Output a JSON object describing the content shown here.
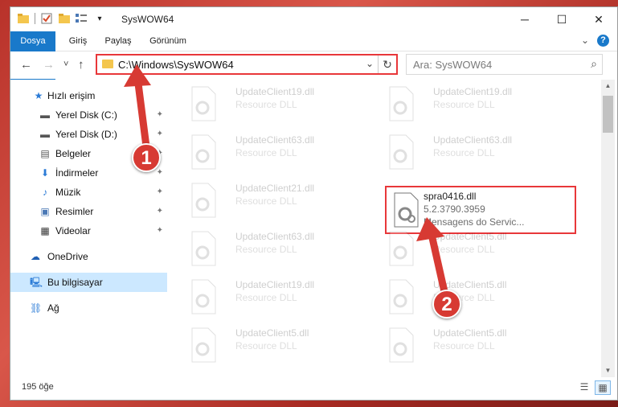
{
  "window": {
    "title": "SysWOW64",
    "controls": {
      "minimize": "─",
      "maximize": "☐",
      "close": "✕"
    }
  },
  "ribbon": {
    "tabs": [
      "Dosya",
      "Giriş",
      "Paylaş",
      "Görünüm"
    ],
    "expand": "⌄",
    "help": "?"
  },
  "navigation": {
    "back": "←",
    "forward": "→",
    "recent": "˅",
    "up": "↑",
    "address": "C:\\Windows\\SysWOW64",
    "address_dropdown": "⌄",
    "refresh": "↻",
    "search_placeholder": "Ara: SysWOW64",
    "search_icon": "⌕"
  },
  "sidebar": {
    "quick_access": "Hızlı erişim",
    "items": [
      {
        "label": "Yerel Disk (C:)",
        "icon": "drive-icon",
        "glyph": "▬",
        "pinned": true
      },
      {
        "label": "Yerel Disk (D:)",
        "icon": "drive-icon",
        "glyph": "▬",
        "pinned": true
      },
      {
        "label": "Belgeler",
        "icon": "documents-icon",
        "glyph": "▤",
        "pinned": true
      },
      {
        "label": "İndirmeler",
        "icon": "downloads-icon",
        "glyph": "⬇",
        "pinned": true
      },
      {
        "label": "Müzik",
        "icon": "music-icon",
        "glyph": "♪",
        "pinned": true
      },
      {
        "label": "Resimler",
        "icon": "pictures-icon",
        "glyph": "▣",
        "pinned": true
      },
      {
        "label": "Videolar",
        "icon": "videos-icon",
        "glyph": "▦",
        "pinned": true
      }
    ],
    "onedrive": "OneDrive",
    "this_pc": "Bu bilgisayar",
    "network": "Ağ",
    "pin_glyph": "📌"
  },
  "files": {
    "left_column": [
      {
        "name": "UpdateClient19.dll",
        "type": "Resource DLL"
      },
      {
        "name": "UpdateClient63.dll",
        "type": "Resource DLL"
      },
      {
        "name": "UpdateClient21.dll",
        "type": "Resource DLL"
      },
      {
        "name": "UpdateClient63.dll",
        "type": "Resource DLL"
      },
      {
        "name": "UpdateClient19.dll",
        "type": "Resource DLL"
      },
      {
        "name": "UpdateClient5.dll",
        "type": "Resource DLL"
      }
    ],
    "right_column": [
      {
        "name": "UpdateClient19.dll",
        "type": "Resource DLL"
      },
      {
        "name": "UpdateClient63.dll",
        "type": "Resource DLL"
      },
      {
        "name": "UpdateClient5.dll",
        "type": "Resource DLL"
      },
      {
        "name": "UpdateClient5.dll",
        "type": "Resource DLL"
      },
      {
        "name": "UpdateClient5.dll",
        "type": "Resource DLL"
      }
    ],
    "highlighted": {
      "name": "spra0416.dll",
      "version": "5.2.3790.3959",
      "description": "Mensagens do Servic..."
    }
  },
  "status": {
    "item_count": "195 öğe",
    "view_details": "☰",
    "view_tiles": "▦"
  },
  "annotations": {
    "callout_1": "1",
    "callout_2": "2",
    "color": "#d73a33"
  },
  "colors": {
    "accent": "#1979ca",
    "highlight_border": "#e8373a",
    "selection": "#cce8ff"
  }
}
